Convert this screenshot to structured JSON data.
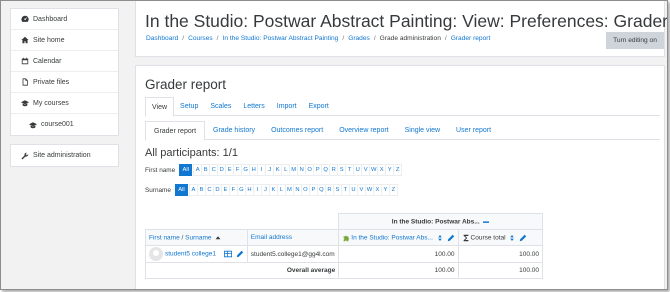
{
  "sidebar": {
    "items": [
      {
        "label": "Dashboard",
        "icon": "tachometer-icon"
      },
      {
        "label": "Site home",
        "icon": "home-icon"
      },
      {
        "label": "Calendar",
        "icon": "calendar-icon"
      },
      {
        "label": "Private files",
        "icon": "file-icon"
      },
      {
        "label": "My courses",
        "icon": "graduation-cap-icon"
      },
      {
        "label": "course001",
        "icon": "graduation-cap-icon"
      }
    ],
    "admin": {
      "label": "Site administration",
      "icon": "wrench-icon"
    }
  },
  "header": {
    "title": "In the Studio: Postwar Abstract Painting: View: Preferences: Grader report",
    "breadcrumb": [
      "Dashboard",
      "Courses",
      "In the Studio: Postwar Abstract Painting",
      "Grades",
      "Grade administration",
      "Grader report"
    ],
    "edit_button": "Turn editing on"
  },
  "main": {
    "heading": "Grader report",
    "tabs": [
      "View",
      "Setup",
      "Scales",
      "Letters",
      "Import",
      "Export"
    ],
    "subtabs": [
      "Grader report",
      "Grade history",
      "Outcomes report",
      "Overview report",
      "Single view",
      "User report"
    ],
    "participants": "All participants: 1/1",
    "firstname_label": "First name",
    "surname_label": "Surname",
    "all_label": "All",
    "letters": [
      "A",
      "B",
      "C",
      "D",
      "E",
      "F",
      "G",
      "H",
      "I",
      "J",
      "K",
      "L",
      "M",
      "N",
      "O",
      "P",
      "Q",
      "R",
      "S",
      "T",
      "U",
      "V",
      "W",
      "X",
      "Y",
      "Z"
    ]
  },
  "table": {
    "category_header": "In the Studio: Postwar Abs...",
    "col_name": "First name / Surname",
    "col_email": "Email address",
    "col_item": "In the Studio: Postwar Abs...",
    "col_total": "Course total",
    "student_name": "student5 college1",
    "student_email": "student5.college1@gg4l.com",
    "student_item": "100.00",
    "student_total": "100.00",
    "avg_label": "Overall average",
    "avg_item": "100.00",
    "avg_total": "100.00"
  },
  "colors": {
    "link": "#1177d1",
    "accent_bg": "#1177d1",
    "button_bg": "#ced4da"
  }
}
